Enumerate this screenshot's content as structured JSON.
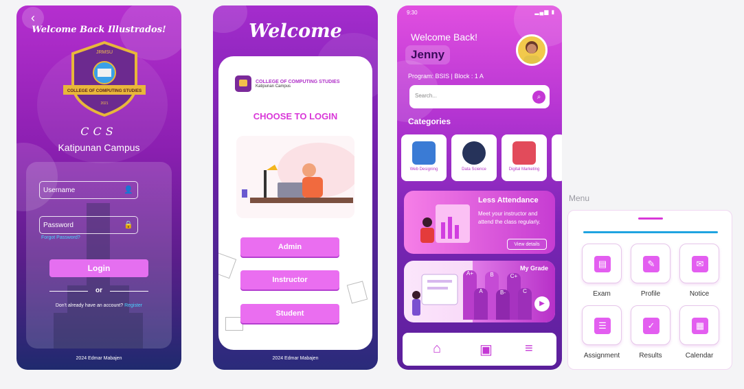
{
  "login_screen": {
    "welcome": "Welcome Back Illustrados!",
    "ccs": "CCS",
    "campus": "Katipunan Campus",
    "username_placeholder": "Username",
    "password_placeholder": "Password",
    "forgot": "Forgot Password?",
    "login_button": "Login",
    "or": "or",
    "no_account": "Don't already have an account?",
    "register": "Register",
    "footer": "2024 Edmar Mabajen",
    "logo_text_top": "JRMSU",
    "logo_ribbon": "COLLEGE OF COMPUTING STUDIES",
    "logo_year": "2021"
  },
  "role_screen": {
    "welcome": "Welcome",
    "college_title": "COLLEGE OF COMPUTING STUDIES",
    "college_campus": "Katipunan Campus",
    "choose": "CHOOSE TO LOGIN",
    "roles": [
      "Admin",
      "Instructor",
      "Student"
    ],
    "footer": "2024 Edmar Mabajen"
  },
  "dashboard": {
    "time": "9:30",
    "welcome": "Welcome Back!",
    "name": "Jenny",
    "program": "Program: BSIS   |   Block : 1 A",
    "search_placeholder": "Search...",
    "categories_title": "Categories",
    "categories": [
      "Web Designing",
      "Data Science",
      "Digital Marketing"
    ],
    "banner1_title": "Less Attendance",
    "banner1_desc": "Meet your instructor and attend the class regularly.",
    "banner1_button": "View details",
    "banner2_title": "My Grade",
    "grades": [
      "A+",
      "B",
      "C+",
      "A",
      "B-",
      "C"
    ]
  },
  "menu": {
    "label": "Menu",
    "items": [
      "Exam",
      "Profile",
      "Notice",
      "Assignment",
      "Results",
      "Calendar"
    ]
  },
  "colors": {
    "accent": "#d937d8",
    "primary": "#8a1fb0",
    "link": "#48d2ff"
  }
}
